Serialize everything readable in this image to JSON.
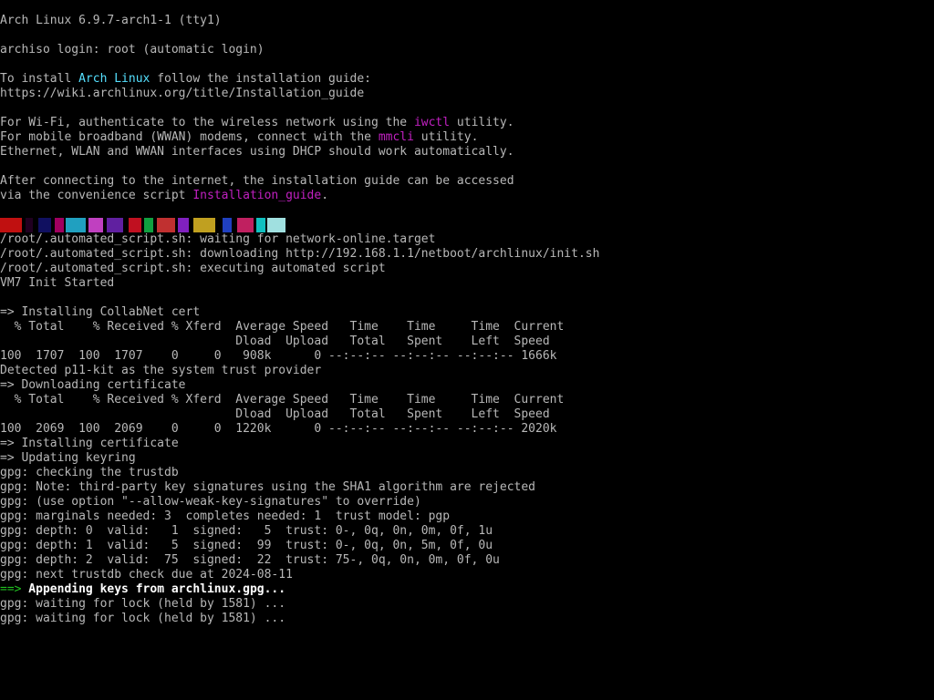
{
  "colors": {
    "background": "#000000",
    "text": "#b8b8b8",
    "highlight_cyan": "#55e0ff",
    "highlight_magenta": "#c020c0",
    "arrow_green": "#20c020",
    "bright_white": "#ffffff"
  },
  "header": {
    "kernel_line": "Arch Linux 6.9.7-arch1-1 (tty1)",
    "login_line": "archiso login: root (automatic login)"
  },
  "motd": {
    "install_prefix": "To install ",
    "install_highlight": "Arch Linux",
    "install_suffix": " follow the installation guide:",
    "install_url": "https://wiki.archlinux.org/title/Installation_guide",
    "wifi_prefix": "For Wi-Fi, authenticate to the wireless network using the ",
    "wifi_highlight": "iwctl",
    "wifi_suffix": " utility.",
    "mobile_prefix": "For mobile broadband (WWAN) modems, connect with the ",
    "mobile_highlight": "mmcli",
    "mobile_suffix": " utility.",
    "ethernet_line": "Ethernet, WLAN and WWAN interfaces using DHCP should work automatically.",
    "after_line": "After connecting to the internet, the installation guide can be accessed",
    "via_prefix": "via the convenience script ",
    "via_highlight": "Installation_guide",
    "via_suffix": "."
  },
  "glitch_colors": [
    "#c01010",
    "#200020",
    "#101060",
    "#a00060",
    "#20a0c0",
    "#c040c0",
    "#6020a0",
    "#c01020",
    "#10a040",
    "#c03030",
    "#8020c0",
    "#c0a020",
    "#2040c0",
    "#c02060",
    "#10c0c0",
    "#a0e0e0"
  ],
  "log_lines": [
    "/root/.automated_script.sh: waiting for network-online.target",
    "/root/.automated_script.sh: downloading http://192.168.1.1/netboot/archlinux/init.sh",
    "/root/.automated_script.sh: executing automated script",
    "VM7 Init Started",
    "",
    "=> Installing CollabNet cert",
    "  % Total    % Received % Xferd  Average Speed   Time    Time     Time  Current",
    "                                 Dload  Upload   Total   Spent    Left  Speed",
    "100  1707  100  1707    0     0   908k      0 --:--:-- --:--:-- --:--:-- 1666k",
    "Detected p11-kit as the system trust provider",
    "=> Downloading certificate",
    "  % Total    % Received % Xferd  Average Speed   Time    Time     Time  Current",
    "                                 Dload  Upload   Total   Spent    Left  Speed",
    "100  2069  100  2069    0     0  1220k      0 --:--:-- --:--:-- --:--:-- 2020k",
    "=> Installing certificate",
    "=> Updating keyring",
    "gpg: checking the trustdb",
    "gpg: Note: third-party key signatures using the SHA1 algorithm are rejected",
    "gpg: (use option \"--allow-weak-key-signatures\" to override)",
    "gpg: marginals needed: 3  completes needed: 1  trust model: pgp",
    "gpg: depth: 0  valid:   1  signed:   5  trust: 0-, 0q, 0n, 0m, 0f, 1u",
    "gpg: depth: 1  valid:   5  signed:  99  trust: 0-, 0q, 0n, 5m, 0f, 0u",
    "gpg: depth: 2  valid:  75  signed:  22  trust: 75-, 0q, 0n, 0m, 0f, 0u",
    "gpg: next trustdb check due at 2024-08-11"
  ],
  "appending": {
    "arrow": "==>",
    "text": " Appending keys from archlinux.gpg..."
  },
  "trailing_lines": [
    "gpg: waiting for lock (held by 1581) ...",
    "gpg: waiting for lock (held by 1581) ..."
  ]
}
